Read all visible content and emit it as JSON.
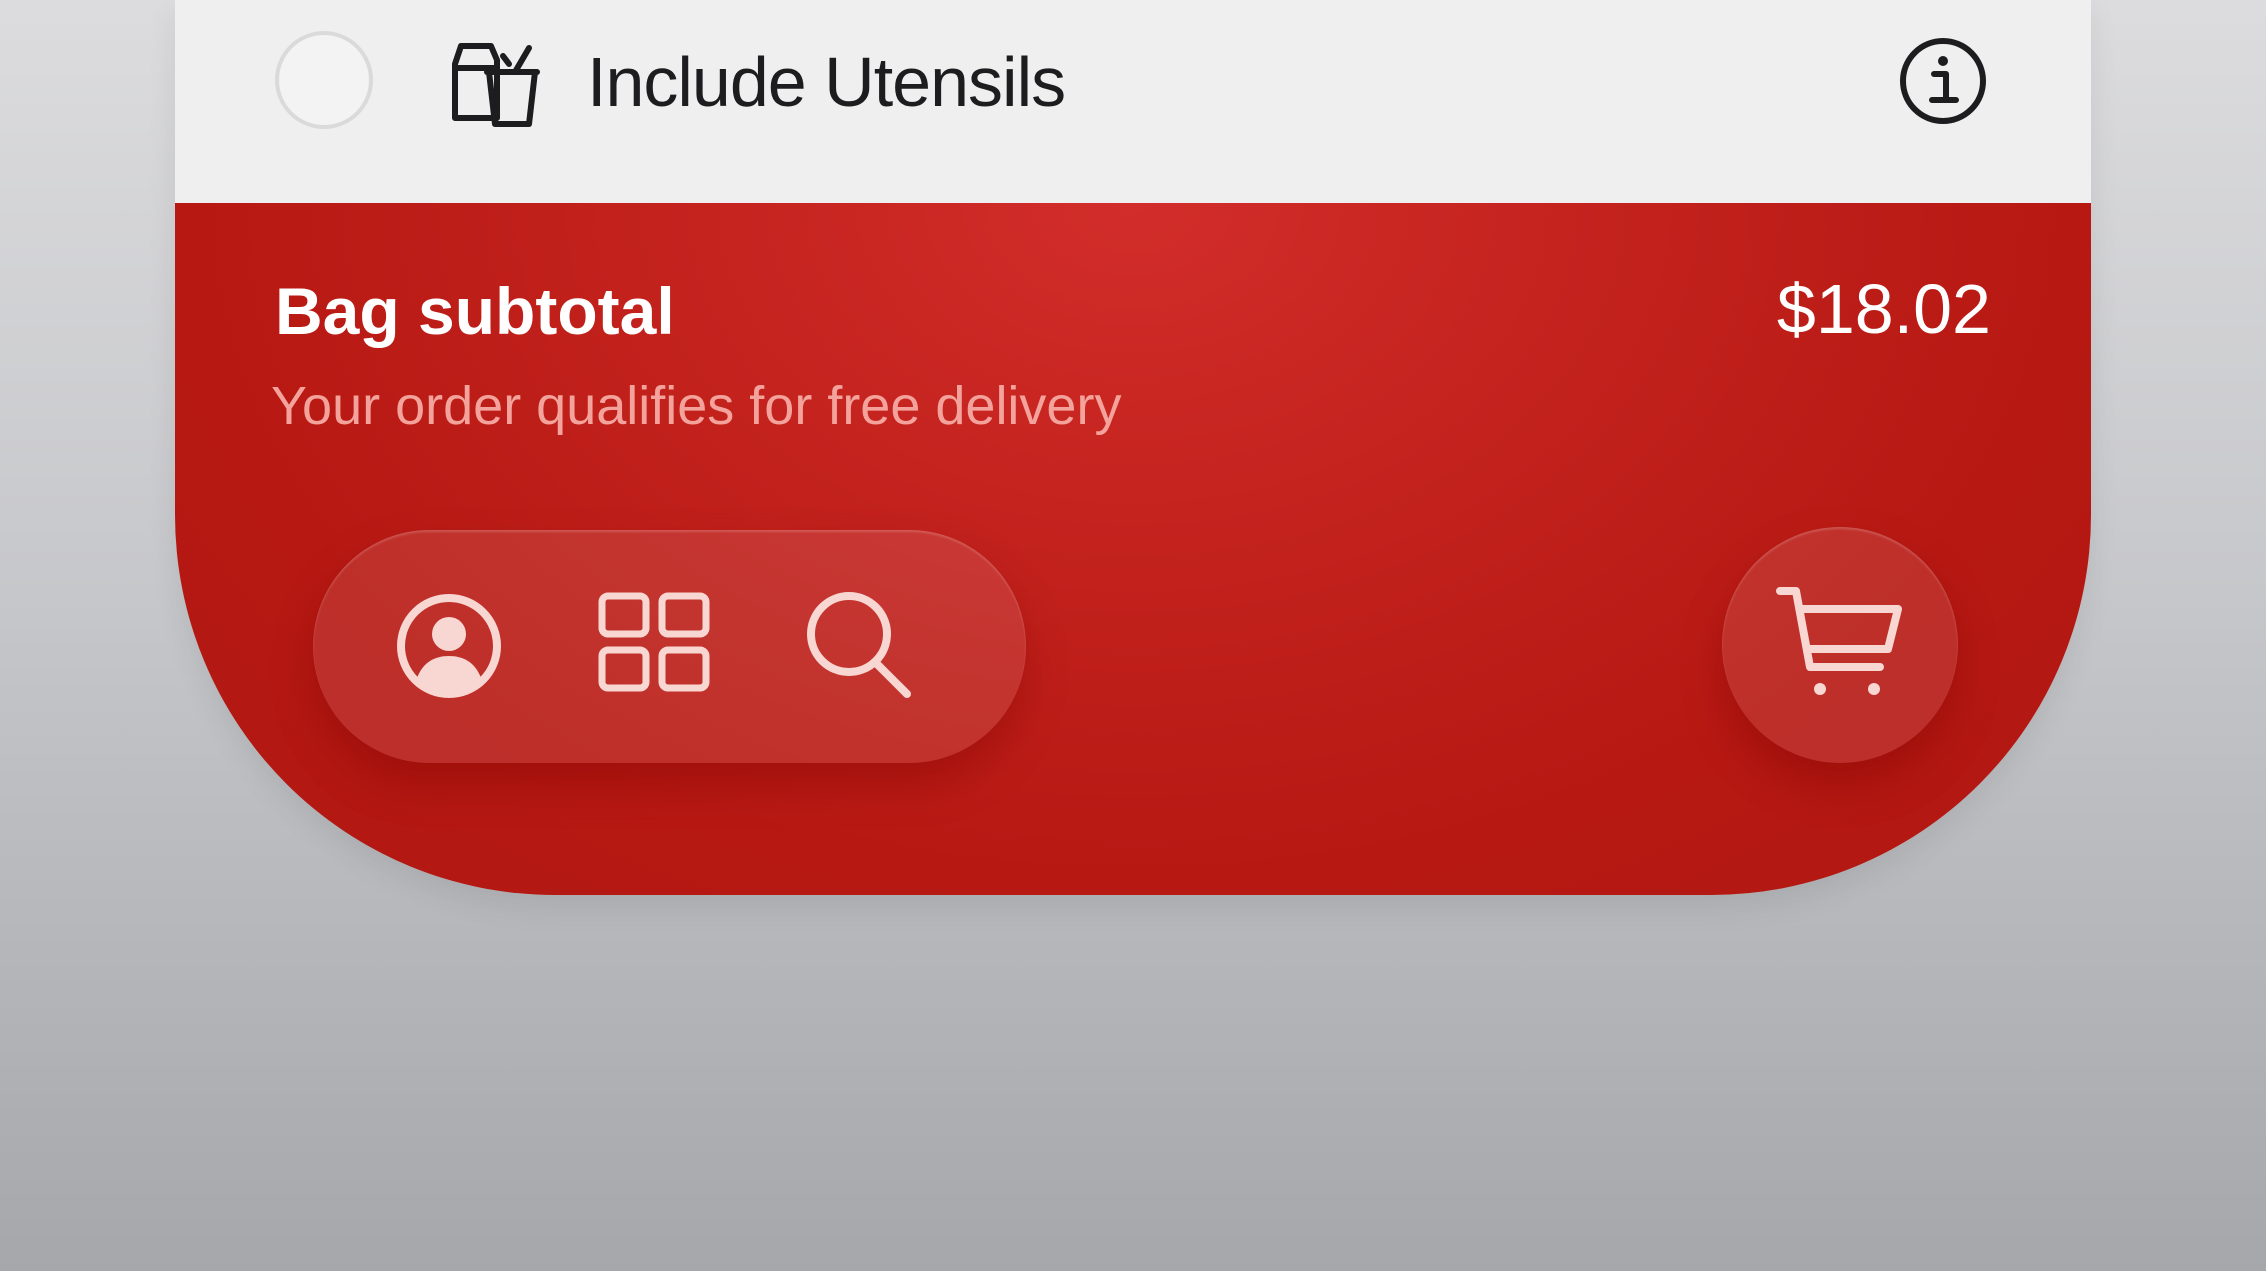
{
  "utensils": {
    "label": "Include Utensils",
    "checked": false,
    "icon": "utensils-bag-cup-icon",
    "info_icon": "info-icon"
  },
  "bag": {
    "title": "Bag subtotal",
    "amount": "$18.02",
    "note": "Your order qualifies for free delivery"
  },
  "tab_bar": {
    "items": [
      {
        "icon": "account-icon"
      },
      {
        "icon": "menu-grid-icon"
      },
      {
        "icon": "search-icon"
      }
    ]
  },
  "cart": {
    "icon": "cart-icon"
  },
  "colors": {
    "panel_red": "#c3221d",
    "note_text": "#f3a39b",
    "icon_tint": "#f8d6d1",
    "row_background": "#efefef"
  }
}
